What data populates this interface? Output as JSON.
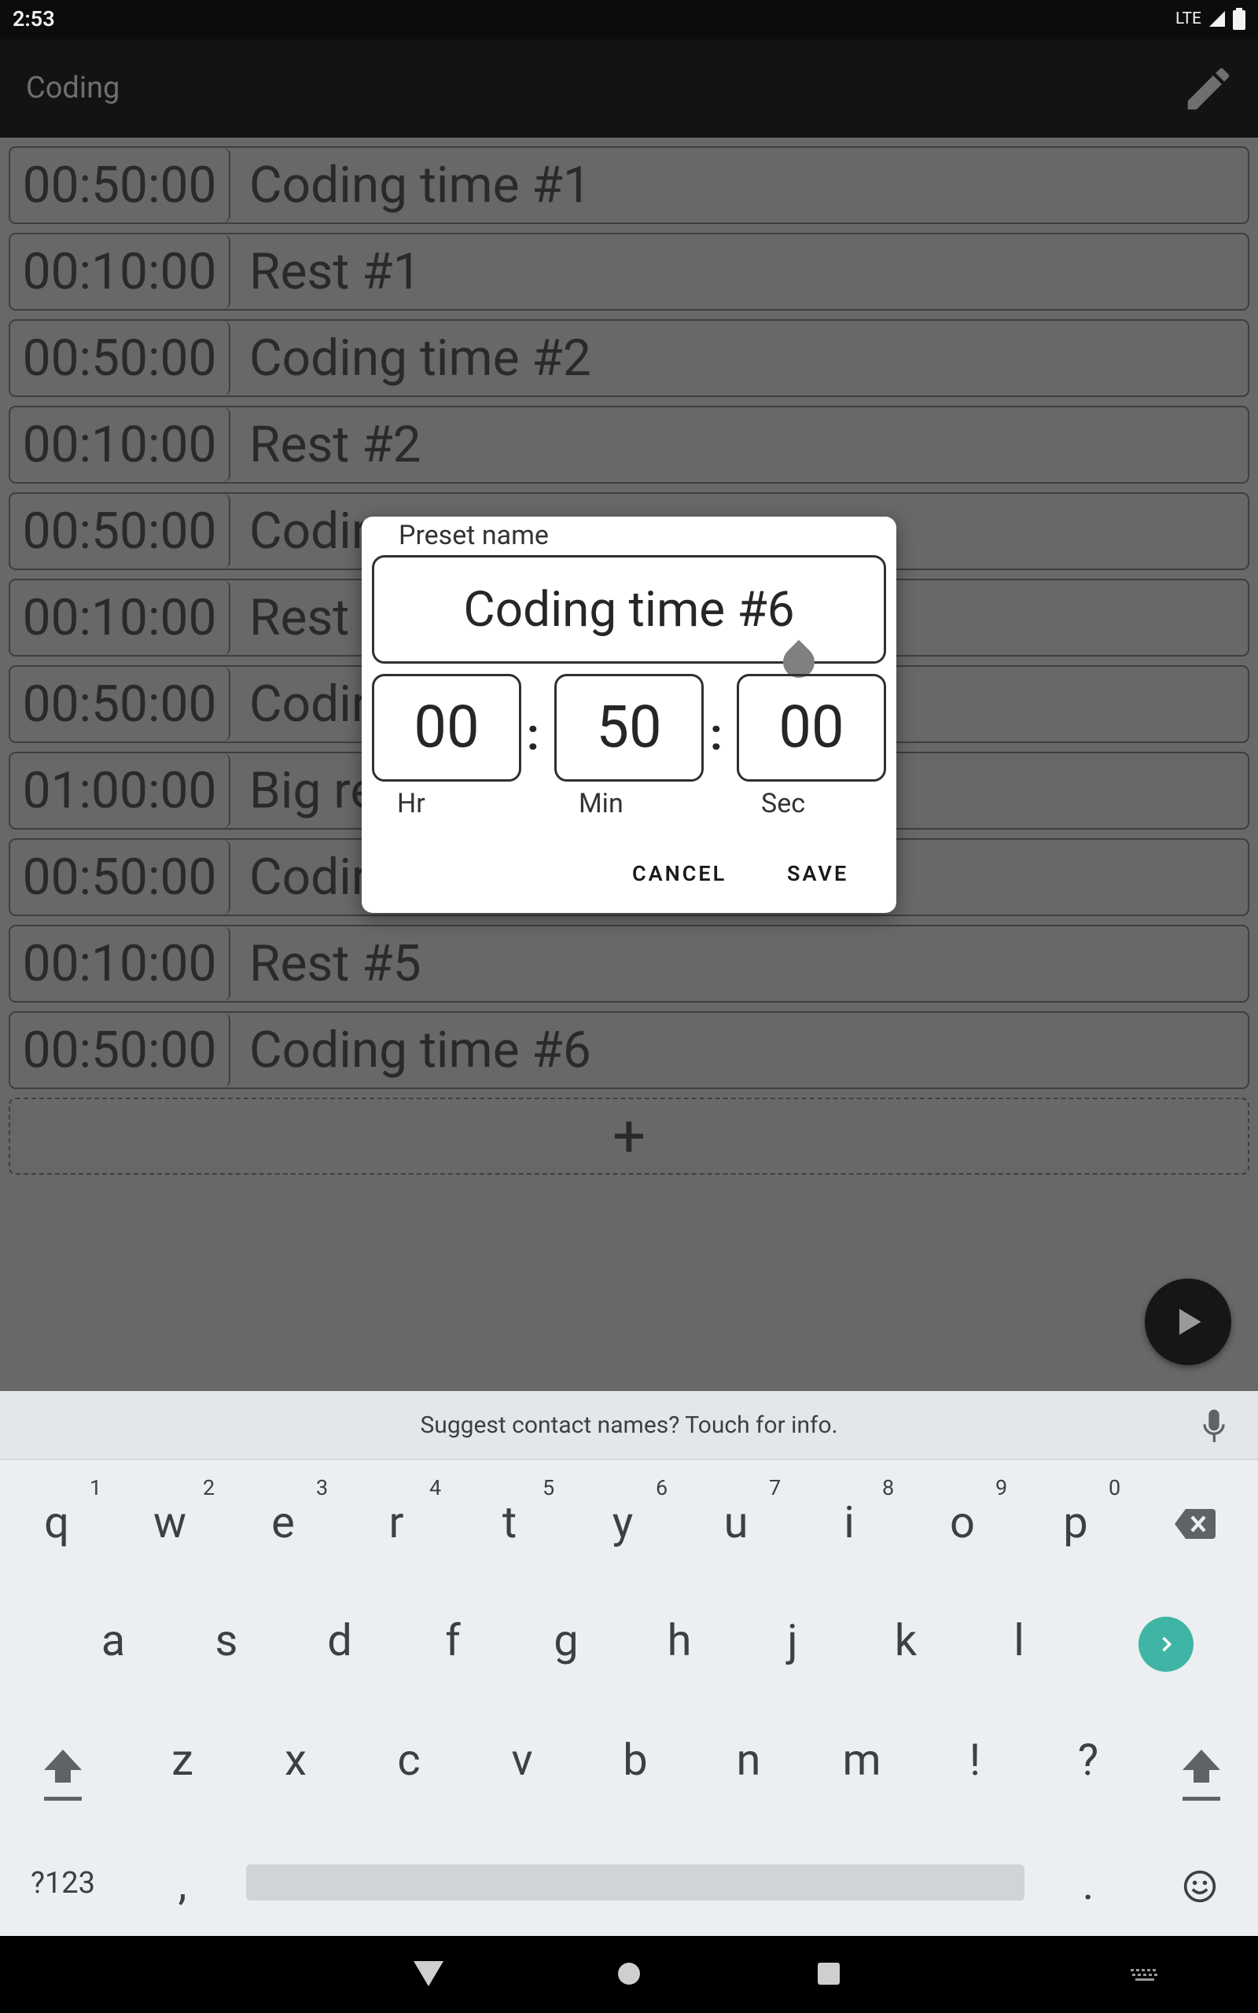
{
  "status_bar": {
    "time": "2:53",
    "network": "LTE"
  },
  "app_bar": {
    "title": "Coding",
    "edit_icon": "pencil-icon"
  },
  "presets": [
    {
      "duration": "00:50:00",
      "name": "Coding time #1"
    },
    {
      "duration": "00:10:00",
      "name": "Rest #1"
    },
    {
      "duration": "00:50:00",
      "name": "Coding time #2"
    },
    {
      "duration": "00:10:00",
      "name": "Rest #2"
    },
    {
      "duration": "00:50:00",
      "name": "Codir"
    },
    {
      "duration": "00:10:00",
      "name": "Rest"
    },
    {
      "duration": "00:50:00",
      "name": "Codir"
    },
    {
      "duration": "01:00:00",
      "name": "Big re"
    },
    {
      "duration": "00:50:00",
      "name": "Codir"
    },
    {
      "duration": "00:10:00",
      "name": "Rest #5"
    },
    {
      "duration": "00:50:00",
      "name": "Coding time #6"
    }
  ],
  "add_button": {
    "label": "+"
  },
  "dialog": {
    "name_label": "Preset name",
    "name_value": "Coding time #6",
    "hours": "00",
    "minutes": "50",
    "seconds": "00",
    "colon": ":",
    "hours_label": "Hr",
    "minutes_label": "Min",
    "seconds_label": "Sec",
    "cancel_label": "CANCEL",
    "save_label": "SAVE"
  },
  "keyboard": {
    "suggestion": "Suggest contact names? Touch for info.",
    "row1": [
      "q",
      "w",
      "e",
      "r",
      "t",
      "y",
      "u",
      "i",
      "o",
      "p"
    ],
    "row1_hints": [
      "1",
      "2",
      "3",
      "4",
      "5",
      "6",
      "7",
      "8",
      "9",
      "0"
    ],
    "row2": [
      "a",
      "s",
      "d",
      "f",
      "g",
      "h",
      "j",
      "k",
      "l"
    ],
    "row3": [
      "z",
      "x",
      "c",
      "v",
      "b",
      "n",
      "m",
      "!",
      "?"
    ],
    "symbols_key": "?123",
    "comma_key": ",",
    "period_key": "."
  },
  "colors": {
    "accent": "#3fb5a5",
    "scrim": "#686868",
    "appbar": "#131313"
  }
}
